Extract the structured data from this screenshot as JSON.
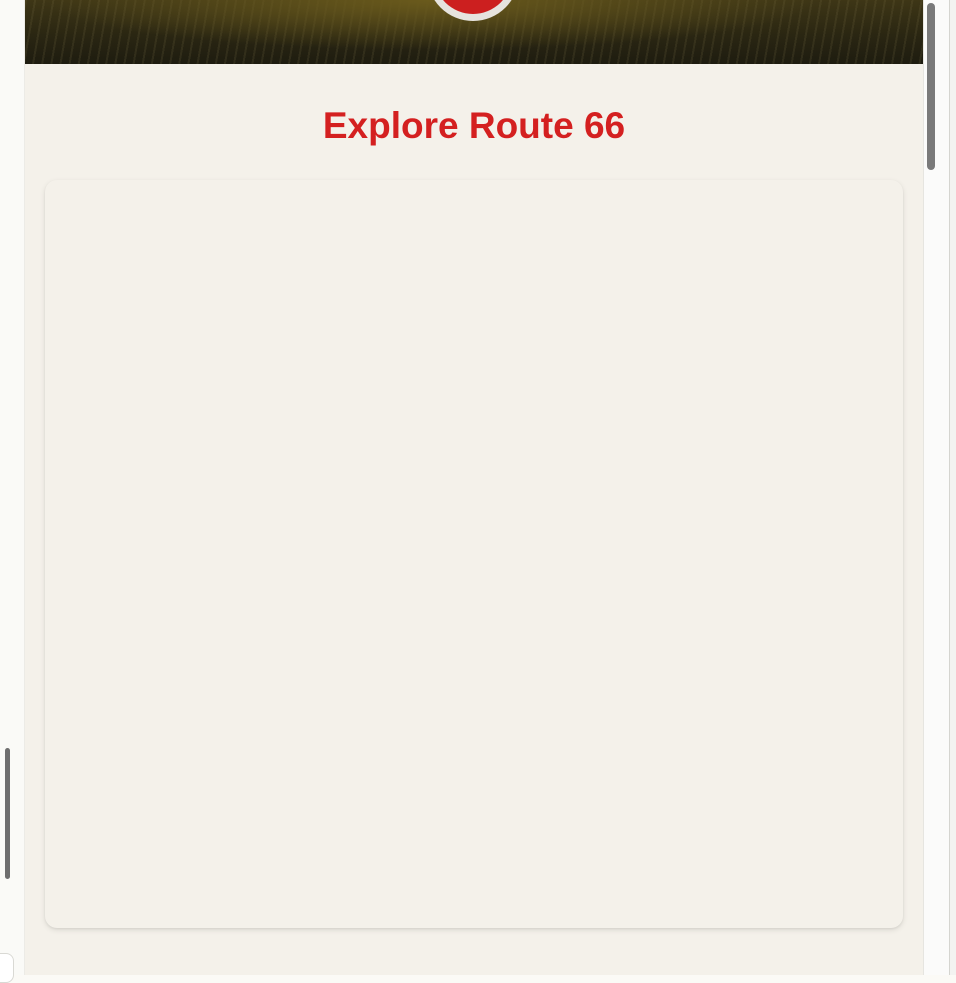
{
  "page": {
    "title": "Explore Route 66"
  },
  "hero": {
    "badge_icon": "route-66-shield-icon",
    "badge_color": "#cc1f1f",
    "badge_ring_color": "#e6e3de"
  },
  "map": {
    "content": ""
  },
  "colors": {
    "title": "#d42020",
    "page_background": "#f4f1ea"
  }
}
